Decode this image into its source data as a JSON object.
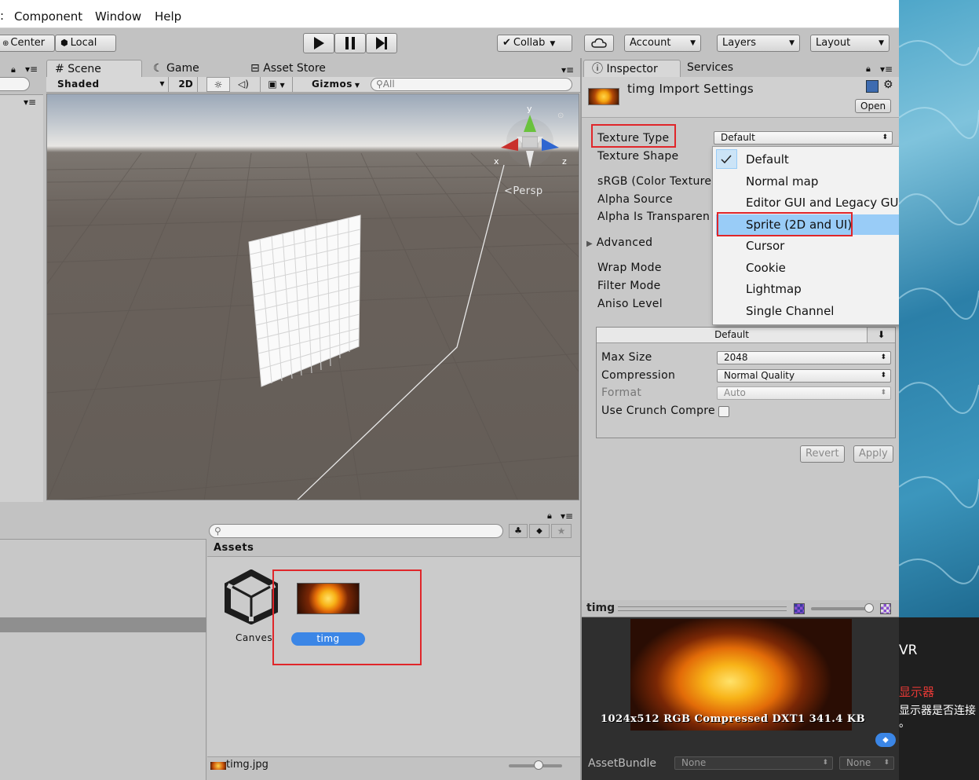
{
  "menu": [
    "Component",
    "Window",
    "Help"
  ],
  "toolbar": {
    "center": "Center",
    "local": "Local",
    "collab": "Collab",
    "account": "Account",
    "layers": "Layers",
    "layout": "Layout"
  },
  "scene": {
    "tabs": {
      "scene": "Scene",
      "game": "Game",
      "asset_store": "Asset Store"
    },
    "shaded": "Shaded",
    "mode_2d": "2D",
    "gizmos": "Gizmos",
    "search_placeholder": "All",
    "gizmo_axes": {
      "x": "x",
      "y": "y",
      "z": "z"
    },
    "persp": "Persp"
  },
  "inspector": {
    "tabs": {
      "inspector": "Inspector",
      "services": "Services"
    },
    "title": "timg Import Settings",
    "open": "Open",
    "fields": {
      "texture_type": "Texture Type",
      "texture_shape": "Texture Shape",
      "srgb": "sRGB (Color Texture",
      "alpha_source": "Alpha Source",
      "alpha_transparent": "Alpha Is Transparen",
      "advanced": "Advanced",
      "wrap_mode": "Wrap Mode",
      "filter_mode": "Filter Mode",
      "aniso_level": "Aniso Level"
    },
    "texture_type_value": "Default",
    "dropdown": {
      "items": [
        "Default",
        "Normal map",
        "Editor GUI and Legacy GUI",
        "Sprite (2D and UI)",
        "Cursor",
        "Cookie",
        "Lightmap",
        "Single Channel"
      ],
      "checked": "Default",
      "highlighted": "Sprite (2D and UI)"
    },
    "platform": {
      "tab": "Default",
      "max_size_label": "Max Size",
      "max_size": "2048",
      "compression_label": "Compression",
      "compression": "Normal Quality",
      "format_label": "Format",
      "format": "Auto",
      "crunch_label": "Use Crunch Compre"
    },
    "revert": "Revert",
    "apply": "Apply"
  },
  "preview": {
    "name": "timg",
    "info": "1024x512  RGB Compressed DXT1   341.4 KB",
    "assetbundle_label": "AssetBundle",
    "assetbundle": "None",
    "variant": "None"
  },
  "project": {
    "breadcrumb": "Assets",
    "assets": [
      {
        "name": "Canves"
      },
      {
        "name": "timg"
      }
    ],
    "footer_file": "timg.jpg"
  },
  "desktop": {
    "vr": "VR",
    "red_text": "显示器",
    "line1": "显示器是否连接",
    "line2": "。"
  },
  "colors": {
    "selection_blue": "#3b86e6",
    "highlight_blue": "#99ccf7",
    "annotation_red": "#e0262a",
    "scene_ground": "#6a625c"
  }
}
